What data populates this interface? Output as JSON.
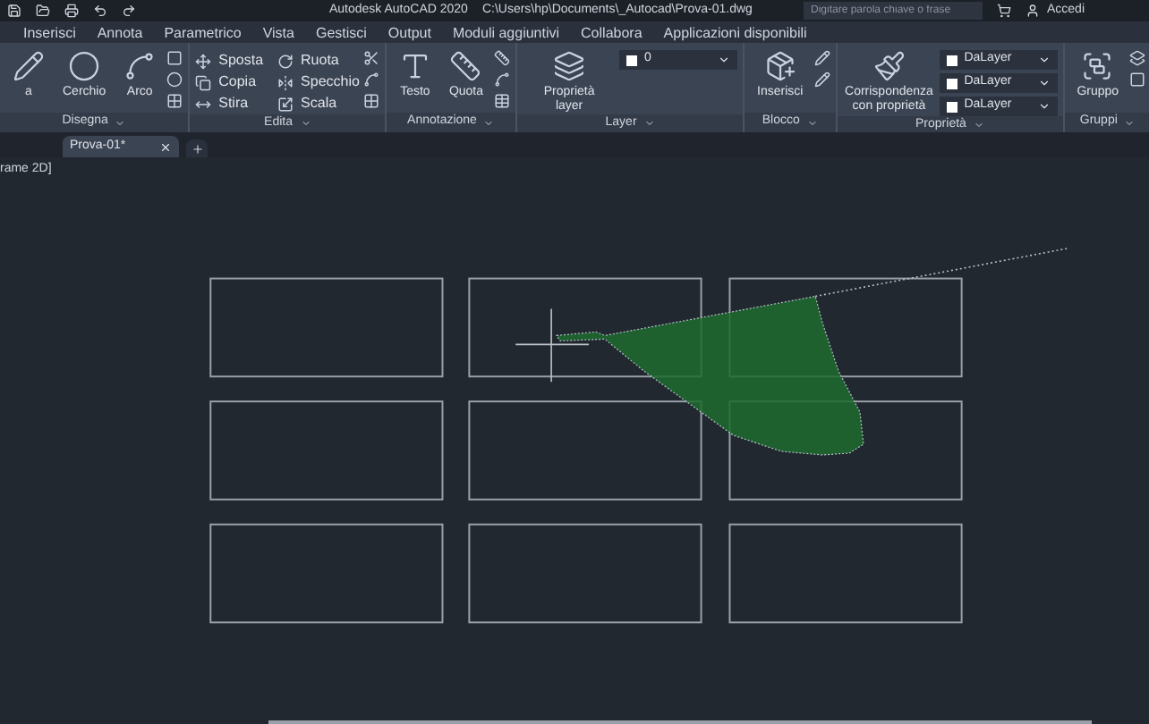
{
  "title_bar": {
    "title": "Autodesk AutoCAD 2020",
    "path": "C:\\Users\\hp\\Documents\\_Autocad\\Prova-01.dwg",
    "search": {
      "placeholder": "Digitare parola chiave o frase"
    },
    "sign_in": "Accedi"
  },
  "ribbon_tabs": [
    {
      "label": "Inserisci",
      "selected": false
    },
    {
      "label": "Annota",
      "selected": false
    },
    {
      "label": "Parametrico",
      "selected": false
    },
    {
      "label": "Vista",
      "selected": false
    },
    {
      "label": "Gestisci",
      "selected": false
    },
    {
      "label": "Output",
      "selected": false
    },
    {
      "label": "Moduli aggiuntivi",
      "selected": false
    },
    {
      "label": "Collabora",
      "selected": false
    },
    {
      "label": "Applicazioni disponibili",
      "selected": false
    }
  ],
  "ribbon_panels": [
    {
      "title": "Disegna",
      "tools": [
        {
          "kind": "large",
          "label": "a"
        },
        {
          "kind": "large",
          "label": "Cerchio"
        },
        {
          "kind": "large",
          "label": "Arco"
        }
      ]
    },
    {
      "title": "Edita",
      "tools": [
        {
          "kind": "small",
          "label": "Sposta"
        },
        {
          "kind": "small",
          "label": "Copia"
        },
        {
          "kind": "small",
          "label": "Stira"
        },
        {
          "kind": "small",
          "label": "Ruota"
        },
        {
          "kind": "small",
          "label": "Specchio"
        },
        {
          "kind": "small",
          "label": "Scala"
        }
      ]
    },
    {
      "title": "Annotazione",
      "tools": [
        {
          "kind": "large",
          "label": "Testo"
        },
        {
          "kind": "large",
          "label": "Quota"
        }
      ]
    },
    {
      "title": "Layer",
      "tools": [
        {
          "kind": "large",
          "label": "Proprietà layer"
        },
        {
          "kind": "dropdown",
          "label": "0"
        }
      ]
    },
    {
      "title": "Blocco",
      "tools": [
        {
          "kind": "large",
          "label": "Inserisci"
        }
      ]
    },
    {
      "title": "Proprietà",
      "tools": [
        {
          "kind": "large",
          "label": "Corrispondenza con proprietà"
        },
        {
          "kind": "dropdown",
          "label": "DaLayer"
        },
        {
          "kind": "dropdown",
          "label": "DaLayer"
        },
        {
          "kind": "dropdown",
          "label": "DaLayer"
        }
      ]
    },
    {
      "title": "Gruppi",
      "tools": [
        {
          "kind": "large",
          "label": "Gruppo"
        }
      ]
    }
  ],
  "document_tabs": [
    {
      "label": "Prova-01*",
      "selected": true
    }
  ],
  "viewport_label": "rame 2D]"
}
